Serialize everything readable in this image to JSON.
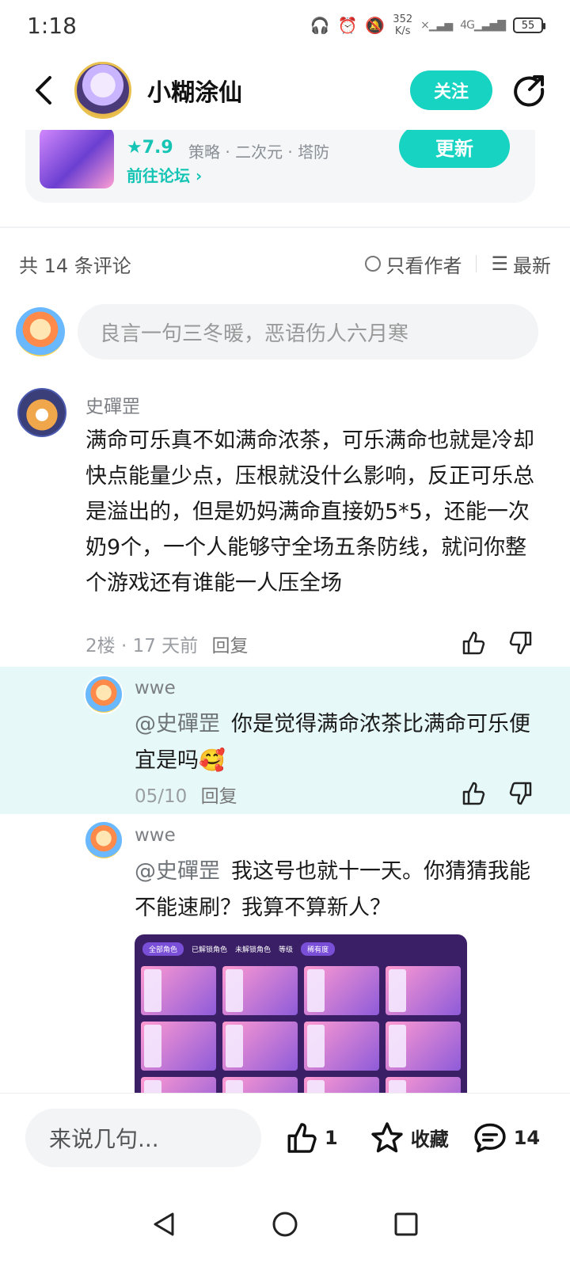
{
  "status_bar": {
    "time": "1:18",
    "net_speed_value": "352",
    "net_speed_unit": "K/s",
    "network": "4G",
    "battery": "55"
  },
  "header": {
    "name": "小糊涂仙",
    "follow_label": "关注"
  },
  "game_card": {
    "rating": "7.9",
    "tags": "策略 · 二次元 · 塔防",
    "forum_link": "前往论坛",
    "update_label": "更新"
  },
  "comments_bar": {
    "count_label": "共 14 条评论",
    "author_only_label": "只看作者",
    "sort_label": "最新"
  },
  "comment_input": {
    "placeholder": "良言一句三冬暖，恶语伤人六月寒"
  },
  "comment": {
    "author": "史磾罡",
    "text": "满命可乐真不如满命浓茶，可乐满命也就是冷却快点能量少点，压根就没什么影响，反正可乐总是溢出的，但是奶妈满命直接奶5*5，还能一次奶9个，一个人能够守全场五条防线，就问你整个游戏还有谁能一人压全场",
    "floor": "2楼",
    "time": "17 天前",
    "reply_label": "回复"
  },
  "replies": [
    {
      "author": "wwe",
      "mention": "@史磾罡",
      "text": "你是觉得满命浓茶比满命可乐便宜是吗",
      "emoji": "🥰",
      "date": "05/10",
      "reply_label": "回复"
    },
    {
      "author": "wwe",
      "mention": "@史磾罡",
      "text": "我这号也就十一天。你猜猜我能不能速刷？我算不算新人？"
    }
  ],
  "attachment": {
    "tab_all": "全部角色",
    "tab_unlocked": "已解锁角色",
    "tab_locked": "未解锁角色",
    "tab_level": "等级",
    "tab_rarity": "稀有度"
  },
  "bottom_bar": {
    "say_placeholder": "来说几句...",
    "like_count": "1",
    "fav_label": "收藏",
    "comment_count": "14"
  },
  "colors": {
    "accent": "#17d3c2",
    "highlight_bg": "#e6f9f8"
  }
}
